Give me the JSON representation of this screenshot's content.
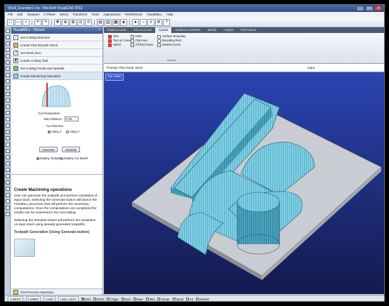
{
  "window": {
    "title": "SKull_Example1.vcp - MecSoft VisualCAD 2012",
    "buttons": [
      "_",
      "□",
      "X"
    ]
  },
  "menu": [
    "File",
    "Edit",
    "Viewport",
    "C-Plane",
    "Select",
    "Transform",
    "Tools",
    "Appearance",
    "Preferences",
    "VisualMILL",
    "Help"
  ],
  "panel": {
    "title": "VisualMILL - Wizard",
    "close": "×",
    "steps": [
      {
        "label": "Set Cutting Direction",
        "icon": "arrow-icon"
      },
      {
        "label": "Create Part Bounds Stock",
        "icon": "stock-icon"
      },
      {
        "label": "Set Work Zero",
        "icon": "zero-icon"
      },
      {
        "label": "Create Cutting Tool",
        "icon": "tool-icon"
      },
      {
        "label": "Set Cutting Feeds and Speeds",
        "icon": "feed-icon"
      },
      {
        "label": "Create Machining Operation",
        "icon": "operation-icon"
      }
    ],
    "params": {
      "title": "Cut Parameters",
      "step_label": "Step Distance",
      "step_value": "0.05",
      "dir_label": "Cut Direction",
      "along_x": "Along X",
      "along_y": "Along Y",
      "generate": "Generate",
      "simulate": "Simulate",
      "disp_toolpath": "Display Toolpath",
      "disp_cut_model": "Display Cut Model"
    },
    "help": {
      "heading": "Create Machining operations",
      "p1": "User can generate the toolpath and perform simulation of input stock. Selecting the Generate button will launch the FreeMILL processor that will perform the necessary computations. Once the computations are completed the results can be examined in the next dialog.",
      "p2": "Selecting the Simulate button will perform the simulation on input stock using already generated toolpaths.",
      "h2": "Toolpath Generation (Using Generate button)"
    },
    "post": "Post-Process Operation"
  },
  "ribbon": {
    "tabs": [
      "Points & Lines",
      "Arcs & Circles",
      "Curves",
      "Surfaces & Meshes",
      "Modify",
      "Analyze",
      "Dimensions"
    ],
    "selected_tab": "Curves",
    "col1": [
      "Text",
      "Text on Curve",
      "Spiral"
    ],
    "col2": [
      "Helix",
      "Flat Area",
      "All Flat Areas"
    ],
    "col3": [
      "Surface Boundary",
      "Bounding Rect",
      "Section Curve"
    ],
    "group_label": "Curves"
  },
  "prompt": {
    "label": "Prompt: Flat Areas: Done",
    "input_label": "Input"
  },
  "viewport": {
    "label": "Iso View"
  },
  "status": {
    "x": "1.09073",
    "y": "2.26984",
    "z": "0.000",
    "units": "Units: INCH",
    "snaps": [
      {
        "label": "Grid",
        "on": true
      },
      {
        "label": "Ortho",
        "on": false
      },
      {
        "label": "Origin",
        "on": false
      },
      {
        "label": "End",
        "on": false
      },
      {
        "label": "Near",
        "on": false
      },
      {
        "label": "Mid",
        "on": false
      },
      {
        "label": "Center",
        "on": false
      },
      {
        "label": "Quad",
        "on": false
      },
      {
        "label": "Int",
        "on": false
      },
      {
        "label": "Default",
        "on": false
      }
    ]
  }
}
